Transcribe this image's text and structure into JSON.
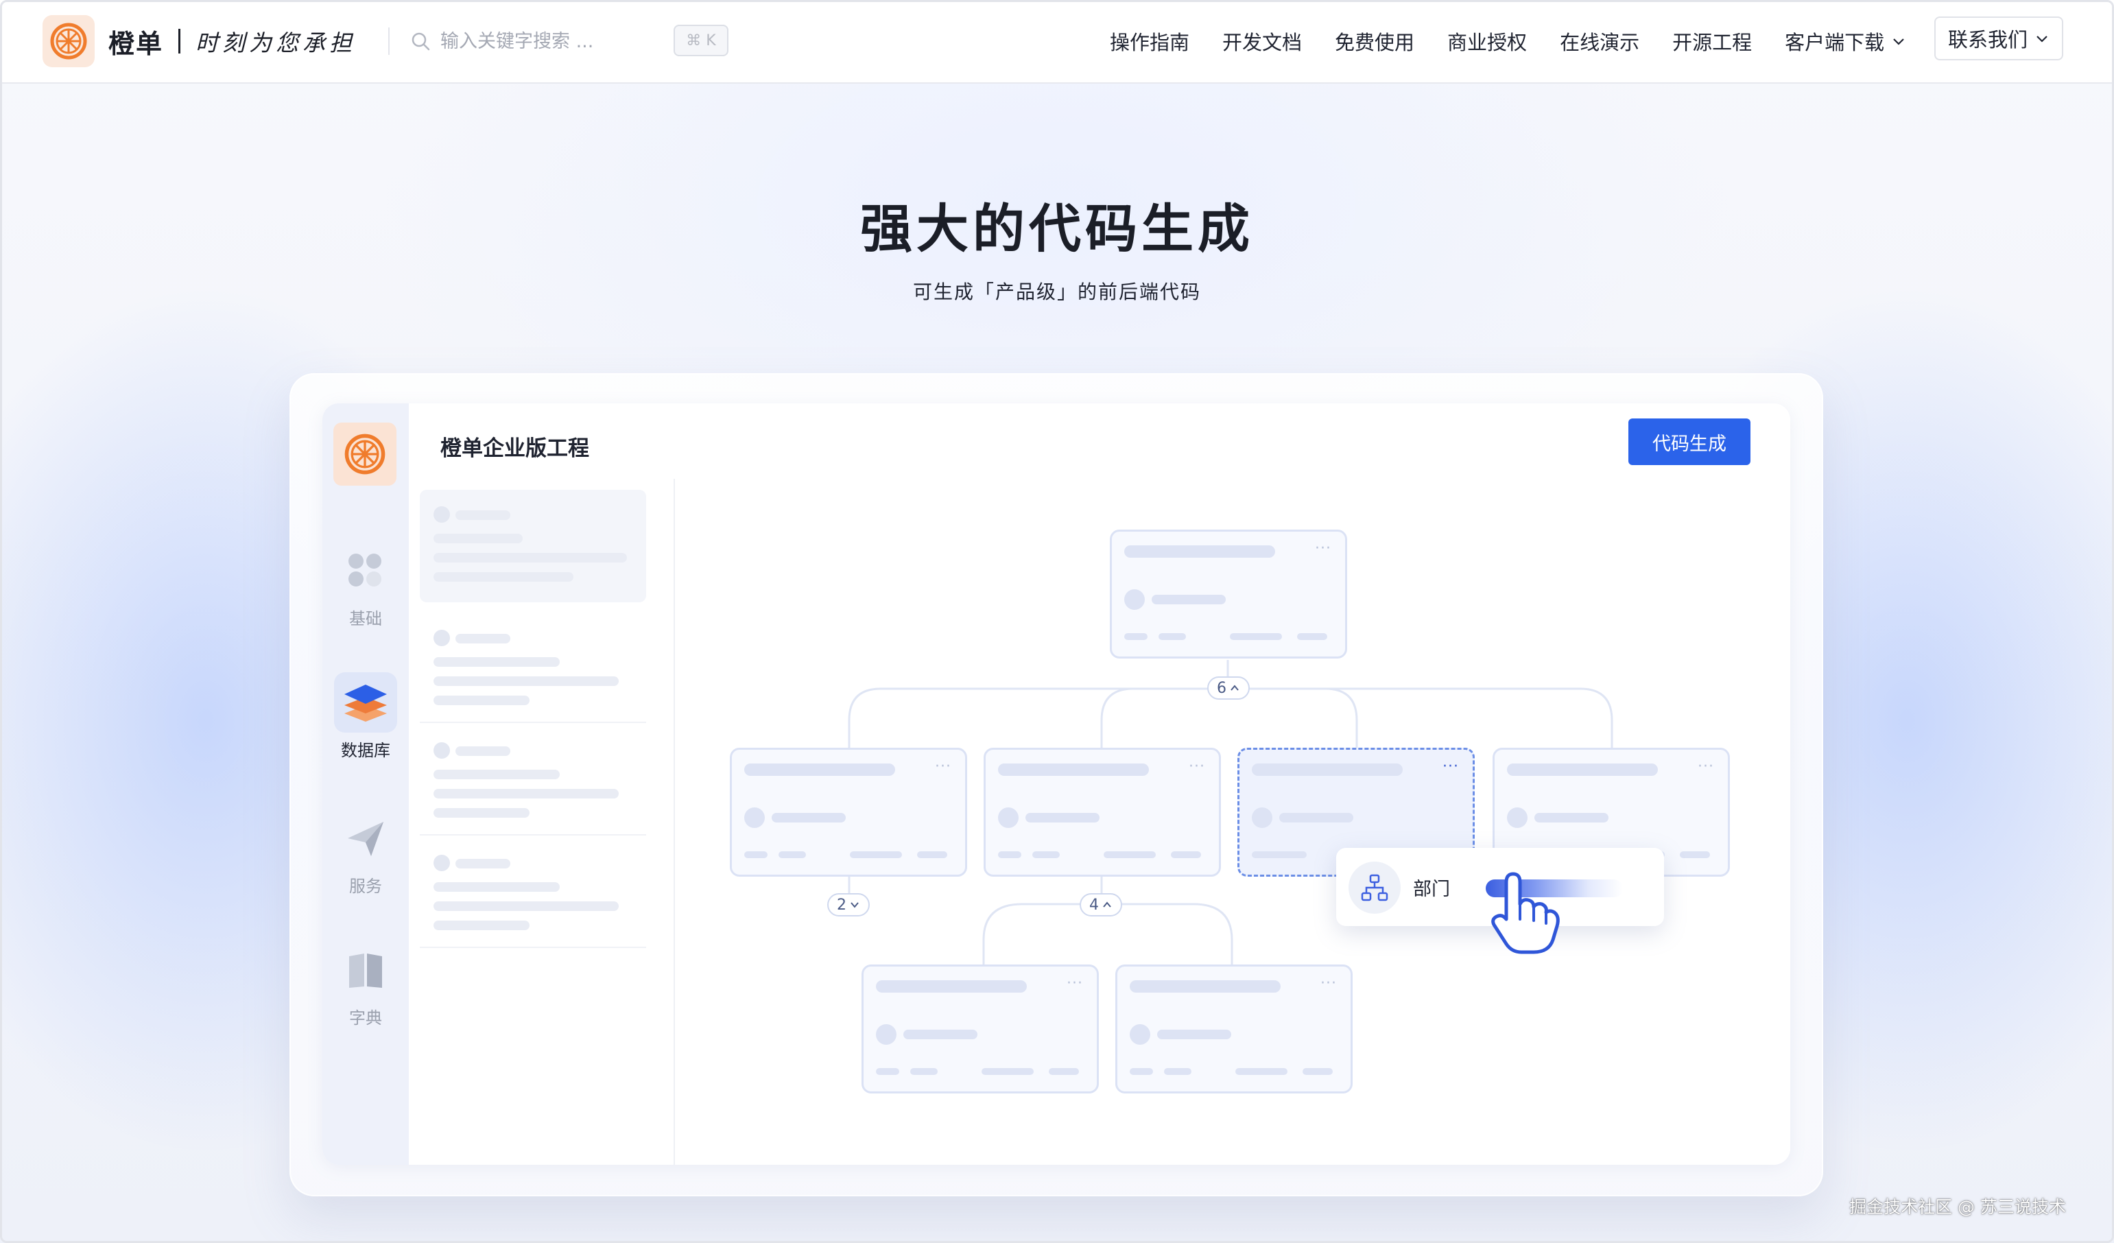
{
  "header": {
    "brand_name": "橙单",
    "slogan": "时刻为您承担",
    "search_placeholder": "输入关键字搜索 ...",
    "search_shortcut": "⌘ K",
    "nav": [
      "操作指南",
      "开发文档",
      "免费使用",
      "商业授权",
      "在线演示",
      "开源工程",
      "客户端下载"
    ],
    "contact_label": "联系我们"
  },
  "hero": {
    "title": "强大的代码生成",
    "subtitle": "可生成「产品级」的前后端代码"
  },
  "app": {
    "title": "橙单企业版工程",
    "generate_button": "代码生成",
    "rail": [
      {
        "label": "基础",
        "icon": "grid-icon",
        "active": false
      },
      {
        "label": "数据库",
        "icon": "database-layers-icon",
        "active": true
      },
      {
        "label": "服务",
        "icon": "send-icon",
        "active": false
      },
      {
        "label": "字典",
        "icon": "book-icon",
        "active": false
      }
    ],
    "tree": {
      "root_children_count": "6",
      "left_children_count": "2",
      "mid_children_count": "4"
    },
    "popup_label": "部门"
  },
  "colors": {
    "accent": "#2b63ea",
    "brand_orange": "#f07c2c"
  },
  "watermark": "掘金技术社区 @ 苏三说技术"
}
